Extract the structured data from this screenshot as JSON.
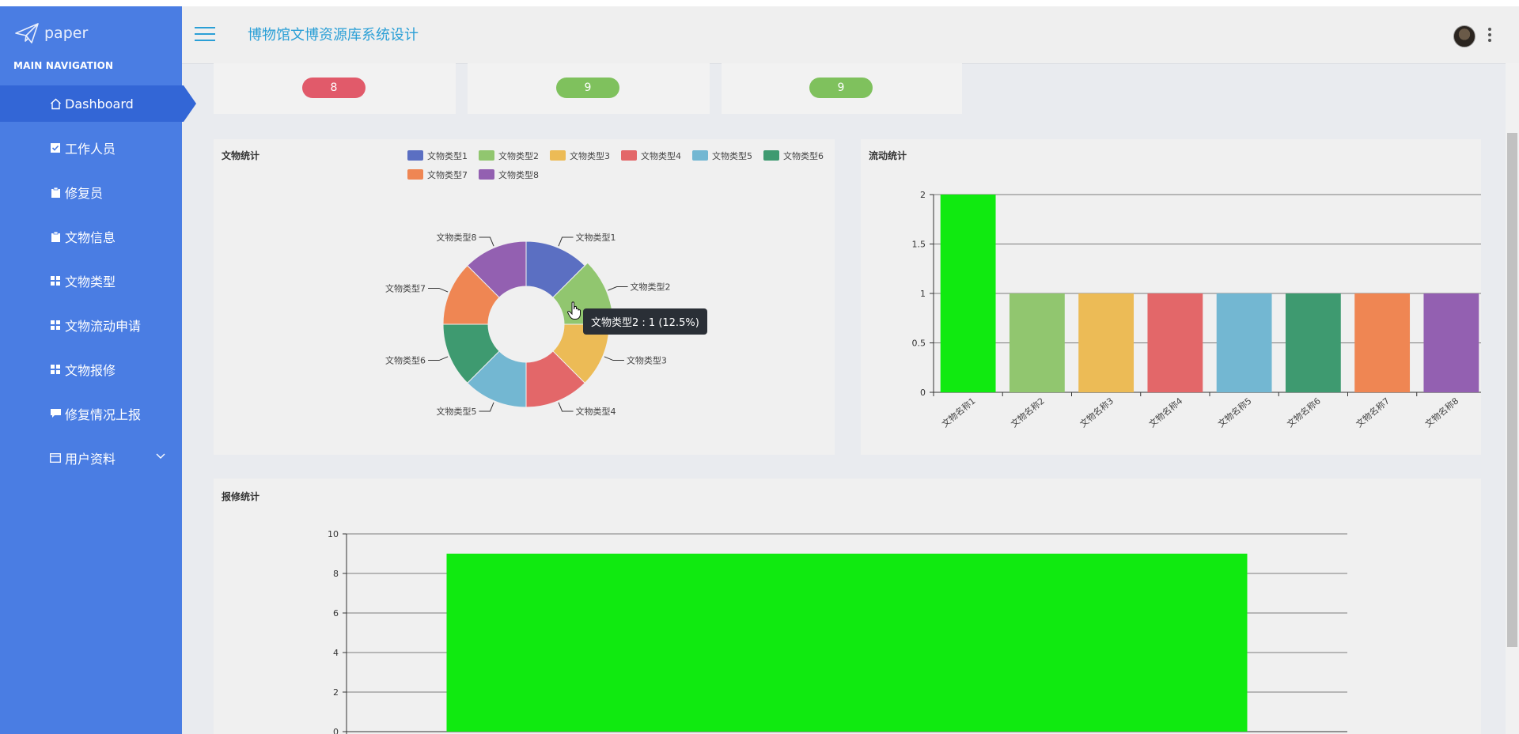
{
  "sidebar": {
    "logo_text": "paper",
    "nav_heading": "MAIN NAVIGATION",
    "items": [
      {
        "label": "Dashboard",
        "icon": "home-icon"
      },
      {
        "label": "工作人员",
        "icon": "check-square-icon"
      },
      {
        "label": "修复员",
        "icon": "clipboard-icon"
      },
      {
        "label": "文物信息",
        "icon": "clipboard-icon"
      },
      {
        "label": "文物类型",
        "icon": "grid-icon"
      },
      {
        "label": "文物流动申请",
        "icon": "grid-icon"
      },
      {
        "label": "文物报修",
        "icon": "grid-icon"
      },
      {
        "label": "修复情况上报",
        "icon": "comment-icon"
      },
      {
        "label": "用户资料",
        "icon": "card-icon"
      }
    ]
  },
  "header": {
    "title": "博物馆文博资源库系统设计"
  },
  "stat_cards": [
    {
      "value": "8",
      "color": "#e15a6a"
    },
    {
      "value": "9",
      "color": "#7fc15d"
    },
    {
      "value": "9",
      "color": "#7fc15d"
    }
  ],
  "pie_panel": {
    "title": "文物统计"
  },
  "flow_panel": {
    "title": "流动统计"
  },
  "repair_panel": {
    "title": "报修统计"
  },
  "tooltip": {
    "text": "文物类型2 : 1 (12.5%)"
  },
  "chart_data": [
    {
      "type": "pie",
      "title": "文物统计",
      "labels": [
        "文物类型1",
        "文物类型2",
        "文物类型3",
        "文物类型4",
        "文物类型5",
        "文物类型6",
        "文物类型7",
        "文物类型8"
      ],
      "values": [
        1,
        1,
        1,
        1,
        1,
        1,
        1,
        1
      ],
      "colors": [
        "#5b6fc2",
        "#91c66f",
        "#ecbb56",
        "#e36769",
        "#73b7d2",
        "#3e9a70",
        "#ef8653",
        "#9360b1"
      ],
      "legend": "top"
    },
    {
      "type": "bar",
      "title": "流动统计",
      "categories": [
        "文物名称1",
        "文物名称2",
        "文物名称3",
        "文物名称4",
        "文物名称5",
        "文物名称6",
        "文物名称7",
        "文物名称8"
      ],
      "values": [
        2,
        1,
        1,
        1,
        1,
        1,
        1,
        1
      ],
      "colors": [
        "#10ea10",
        "#91c66f",
        "#ecbb56",
        "#e36769",
        "#73b7d2",
        "#3e9a70",
        "#ef8653",
        "#9360b1"
      ],
      "yticks": [
        "0",
        "0.5",
        "1",
        "1.5",
        "2"
      ],
      "ylim": [
        0,
        2
      ],
      "grid": true
    },
    {
      "type": "bar",
      "title": "报修统计",
      "categories": [
        ""
      ],
      "values": [
        9
      ],
      "colors": [
        "#10ea10"
      ],
      "yticks": [
        "0",
        "2",
        "4",
        "6",
        "8",
        "10"
      ],
      "ylim": [
        0,
        10
      ],
      "grid": true
    }
  ]
}
